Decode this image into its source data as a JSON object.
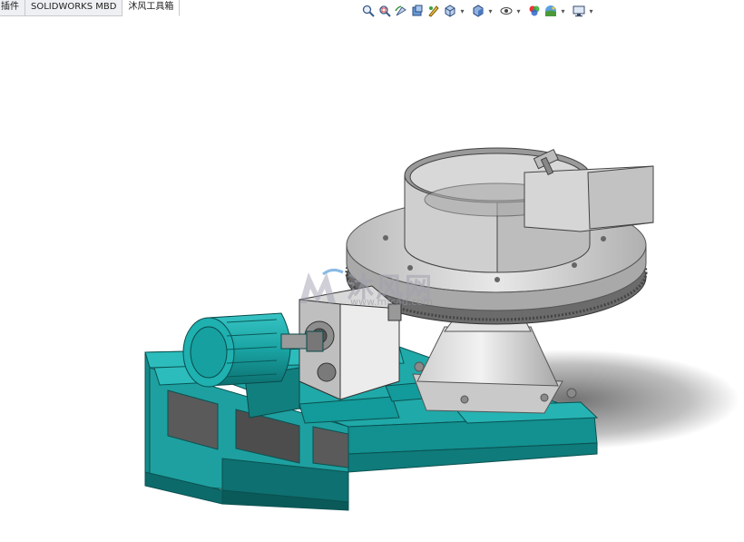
{
  "tabs": [
    {
      "label": "插件",
      "active": false
    },
    {
      "label": "SOLIDWORKS MBD",
      "active": false
    },
    {
      "label": "沐风工具箱",
      "active": true
    }
  ],
  "toolbar_icons": [
    "zoom-to-fit-icon",
    "zoom-to-area-icon",
    "previous-view-icon",
    "section-view-icon",
    "dynamic-annotation-icon",
    "view-orientation-icon",
    "display-style-icon",
    "hide-show-items-icon",
    "edit-appearance-icon",
    "apply-scene-icon",
    "view-settings-icon"
  ],
  "watermark": {
    "text": "沐风网",
    "url": "www.mfcad.com"
  },
  "colors": {
    "frame": "#1fa6a6",
    "frame_dark": "#0f7373",
    "motor": "#1fa6a6",
    "metal": "#d6d6d6",
    "metal_dark": "#9a9a9a"
  }
}
